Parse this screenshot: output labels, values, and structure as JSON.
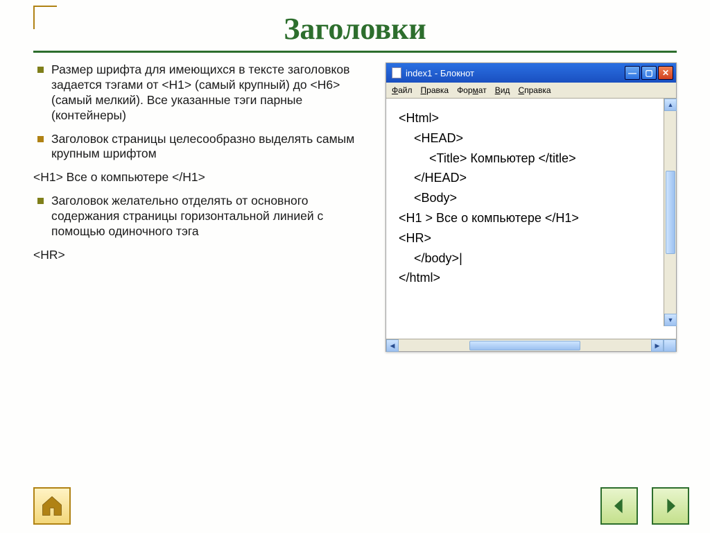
{
  "slide": {
    "title": "Заголовки"
  },
  "bullets": {
    "b1": "Размер шрифта для имеющихся в тексте заголовков задается тэгами от <H1> (самый крупный) до <H6> (самый мелкий). Все указанные тэги парные (контейнеры)",
    "b2": "Заголовок страницы целесообразно выделять самым крупным шрифтом",
    "code_line": "<H1> Все о компьютере </H1>",
    "b3": "Заголовок желательно отделять от основного содержания страницы горизонтальной линией с помощью одиночного тэга",
    "hr_line": "<HR>"
  },
  "window": {
    "title": "index1 - Блокнот",
    "menu": {
      "file": "Файл",
      "edit": "Правка",
      "format": "Формат",
      "view": "Вид",
      "help": "Справка"
    },
    "lines": {
      "l1": "<Html>",
      "l2": "<HEAD>",
      "l3_open": "<Title> ",
      "l3_text": "Компьютер",
      "l3_close": " </title>",
      "l4": "</HEAD>",
      "l5": "<Body>",
      "l6_open": "<H1 > ",
      "l6_text": "Все о компьютере",
      "l6_close": " </H1>",
      "l7": "<HR>",
      "l8": "</body>",
      "l9": "</html>"
    }
  }
}
